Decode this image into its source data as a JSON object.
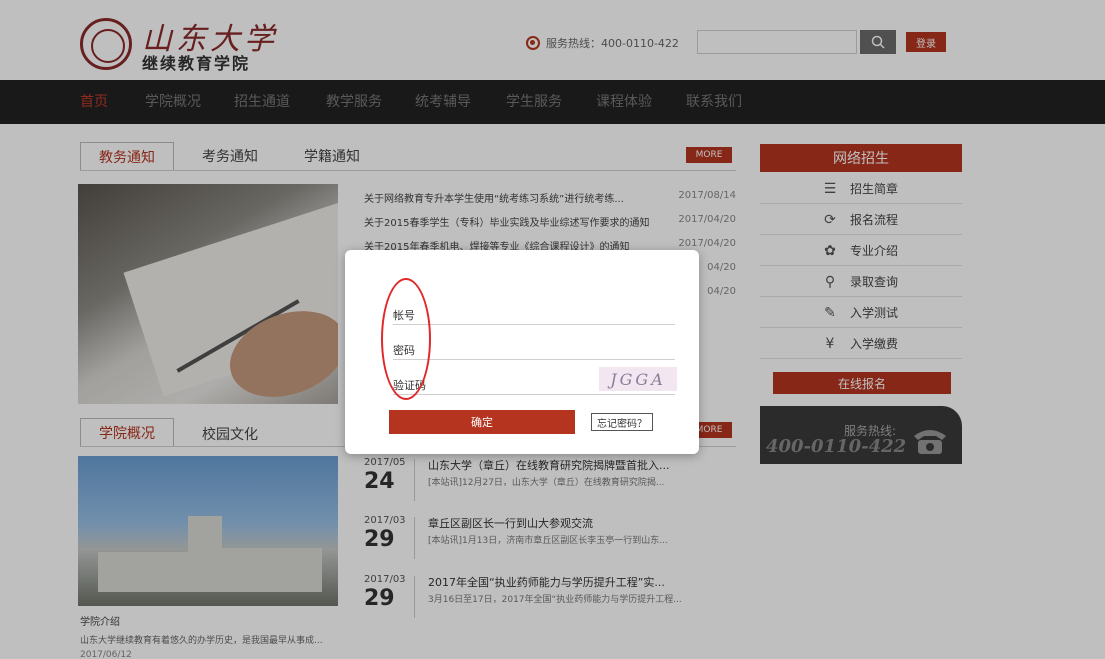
{
  "header": {
    "logo_title": "山东大学",
    "logo_subtitle": "继续教育学院",
    "hotline": "服务热线：400-0110-422",
    "search_placeholder": "",
    "login_label": "登录"
  },
  "nav": {
    "items": [
      {
        "label": "首页",
        "active": true
      },
      {
        "label": "学院概况"
      },
      {
        "label": "招生通道"
      },
      {
        "label": "教学服务"
      },
      {
        "label": "统考辅导"
      },
      {
        "label": "学生服务"
      },
      {
        "label": "课程体验"
      },
      {
        "label": "联系我们"
      }
    ]
  },
  "notices": {
    "tabs": [
      "教务通知",
      "考务通知",
      "学籍通知"
    ],
    "more": "MORE",
    "items": [
      {
        "title": "关于网络教育专升本学生使用“统考练习系统”进行统考练...",
        "date": "2017/08/14"
      },
      {
        "title": "关于2015春季学生（专科）毕业实践及毕业综述写作要求的通知",
        "date": "2017/04/20"
      },
      {
        "title": "关于2015年春季机电、焊接等专业《综合课程设计》的通知",
        "date": "2017/04/20"
      },
      {
        "title": "",
        "date": "04/20"
      },
      {
        "title": "",
        "date": "04/20"
      }
    ]
  },
  "college": {
    "tabs": [
      "学院概况",
      "校园文化"
    ],
    "more": "MORE",
    "caption": "学院介绍",
    "desc": "山东大学继续教育有着悠久的办学历史，是我国最早从事成...",
    "date": "2017/06/12"
  },
  "events": [
    {
      "ym": "2017/05",
      "day": "24",
      "title": "山东大学（章丘）在线教育研究院揭牌暨首批入...",
      "desc": "[本站讯]12月27日，山东大学（章丘）在线教育研究院揭..."
    },
    {
      "ym": "2017/03",
      "day": "29",
      "title": "章丘区副区长一行到山大参观交流",
      "desc": "[本站讯]1月13日，济南市章丘区副区长李玉亭一行到山东..."
    },
    {
      "ym": "2017/03",
      "day": "29",
      "title": "2017年全国“执业药师能力与学历提升工程”实...",
      "desc": "3月16日至17日，2017年全国“执业药师能力与学历提升工程..."
    }
  ],
  "sidebar": {
    "header": "网络招生",
    "items": [
      {
        "label": "招生简章",
        "icon": "list-icon"
      },
      {
        "label": "报名流程",
        "icon": "flow-icon"
      },
      {
        "label": "专业介绍",
        "icon": "atom-icon"
      },
      {
        "label": "录取查询",
        "icon": "search-icon"
      },
      {
        "label": "入学测试",
        "icon": "edit-icon"
      },
      {
        "label": "入学缴费",
        "icon": "yen-icon"
      }
    ],
    "apply": "在线报名",
    "hotline_label": "服务热线:",
    "hotline_number": "400-0110-422"
  },
  "login_modal": {
    "account_label": "帐号",
    "password_label": "密码",
    "captcha_label": "验证码",
    "captcha_text": "JGGA",
    "confirm_label": "确定",
    "forgot_label": "忘记密码？"
  },
  "colors": {
    "brand": "#b5341f",
    "nav_bg": "#222222",
    "annotation": "#e02a2a"
  }
}
